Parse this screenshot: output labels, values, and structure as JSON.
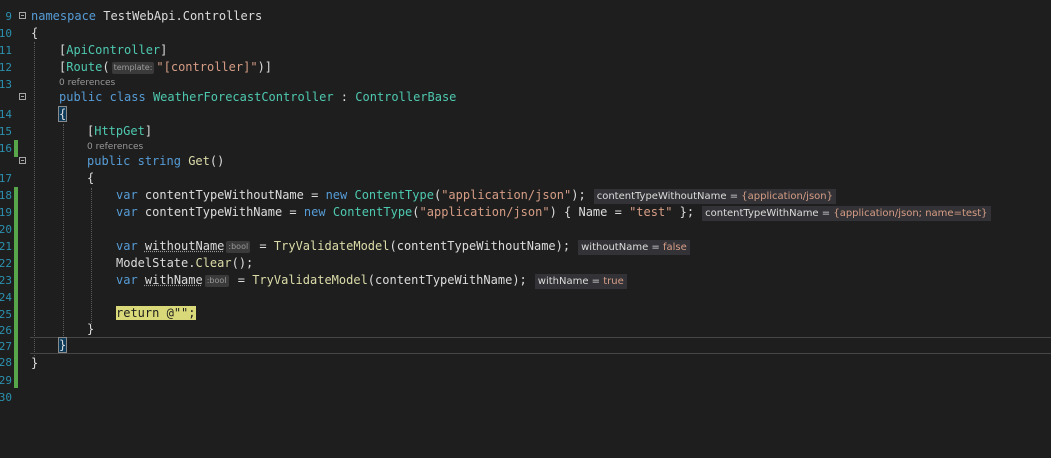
{
  "editor": {
    "colors": {
      "background": "#1e1e1e",
      "keyword": "#569cd6",
      "type": "#4ec9b0",
      "method": "#dcdcaa",
      "string": "#d69d85",
      "line_number": "#2b91af",
      "change_mark": "#57a64a",
      "return_highlight": "#d9d97a"
    },
    "lines": [
      {
        "num": "9"
      },
      {
        "num": "10"
      },
      {
        "num": "11"
      },
      {
        "num": "12"
      },
      {
        "num": "13"
      },
      {
        "num": "14"
      },
      {
        "num": "15"
      },
      {
        "num": "16"
      },
      {
        "num": "17"
      },
      {
        "num": "18"
      },
      {
        "num": "19"
      },
      {
        "num": "20"
      },
      {
        "num": "21"
      },
      {
        "num": "22"
      },
      {
        "num": "23"
      },
      {
        "num": "24"
      },
      {
        "num": "25"
      },
      {
        "num": "26"
      },
      {
        "num": "27"
      },
      {
        "num": "28"
      },
      {
        "num": "29"
      },
      {
        "num": "30"
      }
    ],
    "codelens": {
      "class_refs": "0 references",
      "method_refs": "0 references"
    },
    "tokens": {
      "namespace_kw": "namespace",
      "namespace_name": "TestWebApi.Controllers",
      "open_brace": "{",
      "close_brace": "}",
      "attr_apicontroller": "ApiController",
      "attr_route": "Route",
      "route_hint": "template:",
      "route_value": "\"[controller]\"",
      "public_kw": "public",
      "class_kw": "class",
      "class_name": "WeatherForecastController",
      "base_class": "ControllerBase",
      "attr_httpget": "HttpGet",
      "string_kw": "string",
      "method_name": "Get",
      "var_kw": "var",
      "new_kw": "new",
      "var1_name": "contentTypeWithoutName",
      "var2_name": "contentTypeWithName",
      "content_type": "ContentType",
      "json_literal": "\"application/json\"",
      "name_prop": "Name",
      "test_literal": "\"test\"",
      "var3_name": "withoutName",
      "bool_hint": ":bool",
      "validate_fn": "TryValidateModel",
      "model_state": "ModelState",
      "clear_fn": "Clear",
      "var4_name": "withName",
      "return_kw": "return",
      "return_value": "@\"\""
    },
    "datatips": {
      "tip1_name": "contentTypeWithoutName = ",
      "tip1_value": "{application/json}",
      "tip2_name": "contentTypeWithName = ",
      "tip2_value": "{application/json; name=test}",
      "tip3_name": "withoutName = ",
      "tip3_value": "false",
      "tip4_name": "withName = ",
      "tip4_value": "true"
    }
  }
}
